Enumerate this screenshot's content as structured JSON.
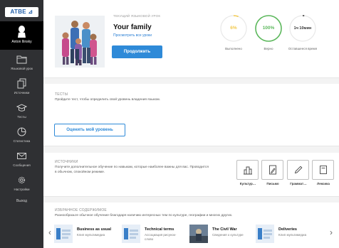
{
  "sidebar": {
    "logo": "ATBE ⊿",
    "user_name": "Anton Ilinsky",
    "items": [
      {
        "label": "Языковой урок",
        "icon": "folder-icon"
      },
      {
        "label": "Источники",
        "icon": "documents-icon"
      },
      {
        "label": "Тесты",
        "icon": "graduation-cap-icon"
      },
      {
        "label": "Статистика",
        "icon": "pie-chart-icon"
      },
      {
        "label": "Сообщения",
        "icon": "envelope-icon"
      },
      {
        "label": "Настройки",
        "icon": "gear-icon"
      }
    ],
    "exit_label": "Выход"
  },
  "lesson": {
    "eyebrow": "ТЕКУЩИЙ ЯЗЫКОВОЙ УРОК",
    "title": "Your family",
    "link": "Просмотреть все уроки",
    "continue_label": "Продолжить"
  },
  "stats": [
    {
      "value": "6%",
      "label": "Выполнено",
      "progress": 0.06,
      "color": "#f2c94c"
    },
    {
      "value": "100%",
      "label": "Верно",
      "progress": 1.0,
      "color": "#5cb85c"
    },
    {
      "value": "1ч 10мин",
      "label": "Оставшееся время",
      "progress": 0.02,
      "color": "#333333"
    }
  ],
  "tests": {
    "title": "ТЕСТЫ",
    "desc": "Пройдите тест, чтобы определить свой уровень владения языком.",
    "button": "Оценить мой уровень"
  },
  "sources": {
    "title": "ИСТОЧНИКИ",
    "desc_1": "Получите дополнительное обучение по навыкам, которые наиболее важны для вас. Проводится",
    "desc_2": "в обычном, спокойном режиме.",
    "items": [
      {
        "label": "Культур…",
        "icon": "building-icon"
      },
      {
        "label": "Письмо",
        "icon": "document-pen-icon"
      },
      {
        "label": "Граммат…",
        "icon": "pencil-icon"
      },
      {
        "label": "Лексика",
        "icon": "notepad-icon"
      }
    ]
  },
  "favorites": {
    "title": "ИЗБРАННОЕ СОДЕРЖИМОЕ",
    "desc": "Разнообразьте обычное обучение благодаря наличию интересных тем по культуре, географии и многих других.",
    "items": [
      {
        "title": "Business as usual",
        "sub_1": "Клип мультимедиа",
        "sub_2": ""
      },
      {
        "title": "Technical terms",
        "sub_1": "Ассоциация рисунок-",
        "sub_2": "слово"
      },
      {
        "title": "The Civil War",
        "sub_1": "Сведения о культуре",
        "sub_2": ""
      },
      {
        "title": "Deliveries",
        "sub_1": "Клип мультимедиа",
        "sub_2": ""
      }
    ]
  }
}
